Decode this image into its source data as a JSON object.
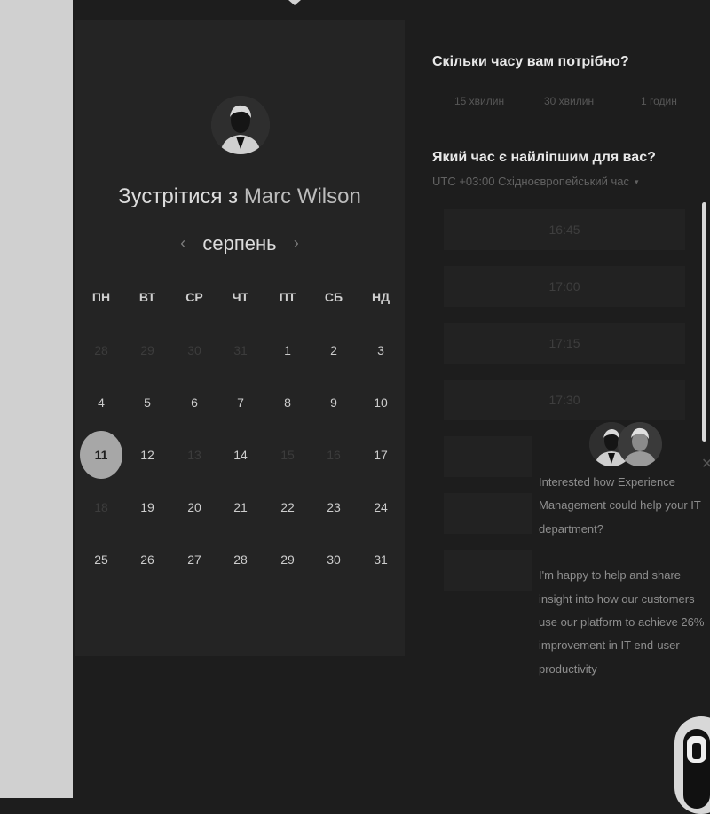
{
  "calendar": {
    "title_prefix": "Зустрітися з",
    "host_name": "Marc Wilson",
    "month": "серпень",
    "prev_arrow": "‹",
    "next_arrow": "›",
    "weekdays": [
      "ПН",
      "ВТ",
      "СР",
      "ЧТ",
      "ПТ",
      "СБ",
      "НД"
    ],
    "weeks": [
      [
        "28",
        "29",
        "30",
        "31",
        "1",
        "2",
        "3"
      ],
      [
        "4",
        "5",
        "6",
        "7",
        "8",
        "9",
        "10"
      ],
      [
        "11",
        "12",
        "13",
        "14",
        "15",
        "16",
        "17"
      ],
      [
        "18",
        "19",
        "20",
        "21",
        "22",
        "23",
        "24"
      ],
      [
        "25",
        "26",
        "27",
        "28",
        "29",
        "30",
        "31"
      ]
    ],
    "muted_days": [
      [
        0,
        0
      ],
      [
        0,
        1
      ],
      [
        0,
        2
      ],
      [
        0,
        3
      ],
      [
        2,
        2
      ],
      [
        2,
        4
      ],
      [
        2,
        5
      ],
      [
        3,
        0
      ]
    ],
    "selected_day": [
      2,
      0
    ]
  },
  "duration": {
    "question": "Скільки часу вам потрібно?",
    "options": [
      "15 хвилин",
      "30 хвилин",
      "1 годин"
    ]
  },
  "time": {
    "question": "Який час є найліпшим для вас?",
    "timezone": "UTC +03:00 Східноєвропейський час",
    "caret": "▾",
    "slots": [
      "16:45",
      "17:00",
      "17:15",
      "17:30",
      "",
      "",
      ""
    ]
  },
  "chat": {
    "close": "✕",
    "lines": [
      "Interested how Experience",
      "Management could help your IT",
      "department?",
      "",
      "I'm happy to help and share",
      "insight into how our customers",
      "use our platform to achieve 26%",
      "improvement in IT end-user",
      "productivity"
    ]
  }
}
